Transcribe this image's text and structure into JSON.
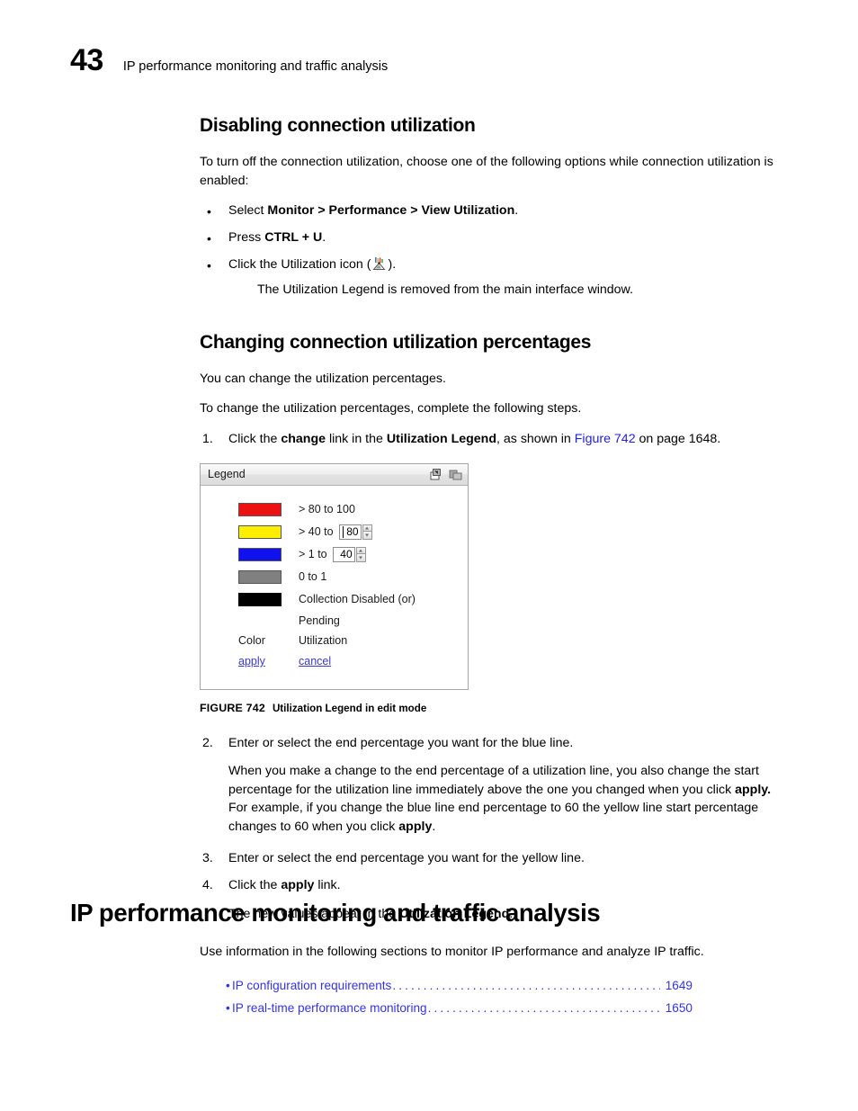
{
  "header": {
    "chapter_number": "43",
    "title": "IP performance monitoring and traffic analysis"
  },
  "section1": {
    "heading": "Disabling connection utilization",
    "intro": "To turn off the connection utilization, choose one of the following options while connection utilization is enabled:",
    "bullets": [
      {
        "prefix": "Select ",
        "bold": "Monitor > Performance > View Utilization",
        "suffix": "."
      },
      {
        "prefix": "Press ",
        "bold": "CTRL + U",
        "suffix": "."
      },
      {
        "prefix": "Click the Utilization icon (",
        "bold": "",
        "suffix": ")."
      }
    ],
    "bullet_marker": "•",
    "note": "The Utilization Legend is removed from the main interface window."
  },
  "section2": {
    "heading": "Changing connection utilization percentages",
    "para1": "You can change the utilization percentages.",
    "para2": "To change the utilization percentages, complete the following steps.",
    "steps": [
      {
        "num": "1.",
        "seg1": "Click the ",
        "bold1": "change",
        "seg2": " link in the ",
        "bold2": "Utilization Legend",
        "seg3": ", as shown in ",
        "link": "Figure 742",
        "seg4": " on page 1648."
      },
      {
        "num": "2.",
        "text": "Enter or select the end percentage you want for the blue line.",
        "para_seg1": "When you make a change to the end percentage of a utilization line, you also change the start percentage for the utilization line immediately above the one you changed when you click ",
        "para_bold1": "apply.",
        "para_seg2": " For example, if you change the blue line end percentage to 60 the yellow line start percentage changes to 60 when you click ",
        "para_bold2": "apply",
        "para_seg3": "."
      },
      {
        "num": "3.",
        "text": "Enter or select the end percentage you want for the yellow line."
      },
      {
        "num": "4.",
        "seg1": "Click the ",
        "bold1": "apply",
        "seg2": " link.",
        "para_seg1": "The new values appear in the ",
        "para_bold1": "Utilization Legend",
        "para_seg2": "."
      }
    ]
  },
  "legend_window": {
    "title": "Legend",
    "titlebar_icons": [
      "restore-window-icon",
      "cascade-window-icon"
    ],
    "rows": [
      {
        "color": "#ee1111",
        "bordered": true,
        "label": "> 80 to 100",
        "input": null
      },
      {
        "color": "#ffee00",
        "bordered": true,
        "label": "> 40 to",
        "input": {
          "value": "80",
          "caret": true
        }
      },
      {
        "color": "#1111ee",
        "bordered": true,
        "label": "> 1 to",
        "input": {
          "value": "40",
          "caret": false
        }
      },
      {
        "color": "#808080",
        "bordered": true,
        "label": "0 to 1",
        "input": null
      },
      {
        "color": "#000000",
        "bordered": false,
        "label": "Collection Disabled (or)",
        "input": null
      }
    ],
    "pending_label": "Pending",
    "col_header_color": "Color",
    "col_header_utilization": "Utilization",
    "apply_link": "apply",
    "cancel_link": "cancel"
  },
  "figure": {
    "label": "FIGURE 742",
    "title": "Utilization Legend in edit mode"
  },
  "chapter_section": {
    "heading": "IP performance monitoring and traffic analysis",
    "intro": "Use information in the following sections to monitor IP performance and analyze IP traffic.",
    "toc_bullet": "•",
    "toc": [
      {
        "title": "IP configuration requirements",
        "page": "1649"
      },
      {
        "title": "IP real-time performance monitoring",
        "page": "1650"
      }
    ]
  },
  "colors": {
    "link": "#3333ee",
    "legend_link": "#3a3ad0"
  }
}
